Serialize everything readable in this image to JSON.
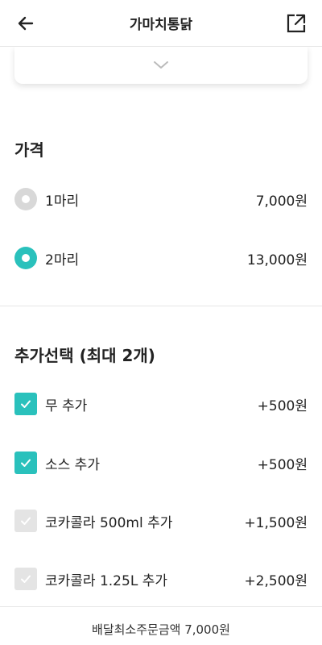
{
  "header": {
    "title": "가마치통닭",
    "back_icon": "arrow-left-icon",
    "share_icon": "external-share-icon"
  },
  "collapse_icon": "chevron-down-icon",
  "price_section": {
    "title": "가격",
    "options": [
      {
        "label": "1마리",
        "price": "7,000원",
        "selected": false
      },
      {
        "label": "2마리",
        "price": "13,000원",
        "selected": true
      }
    ]
  },
  "extra_section": {
    "title": "추가선택 (최대 2개)",
    "options": [
      {
        "label": "무 추가",
        "price": "+500원",
        "state": "checked"
      },
      {
        "label": "소스 추가",
        "price": "+500원",
        "state": "checked"
      },
      {
        "label": "코카콜라 500ml 추가",
        "price": "+1,500원",
        "state": "disabled"
      },
      {
        "label": "코카콜라 1.25L 추가",
        "price": "+2,500원",
        "state": "disabled"
      }
    ]
  },
  "footer": {
    "min_order": "배달최소주문금액 7,000원"
  },
  "colors": {
    "accent": "#2ac1bc",
    "inactive": "#d8d8d8",
    "disabled": "#e4e4e4"
  }
}
